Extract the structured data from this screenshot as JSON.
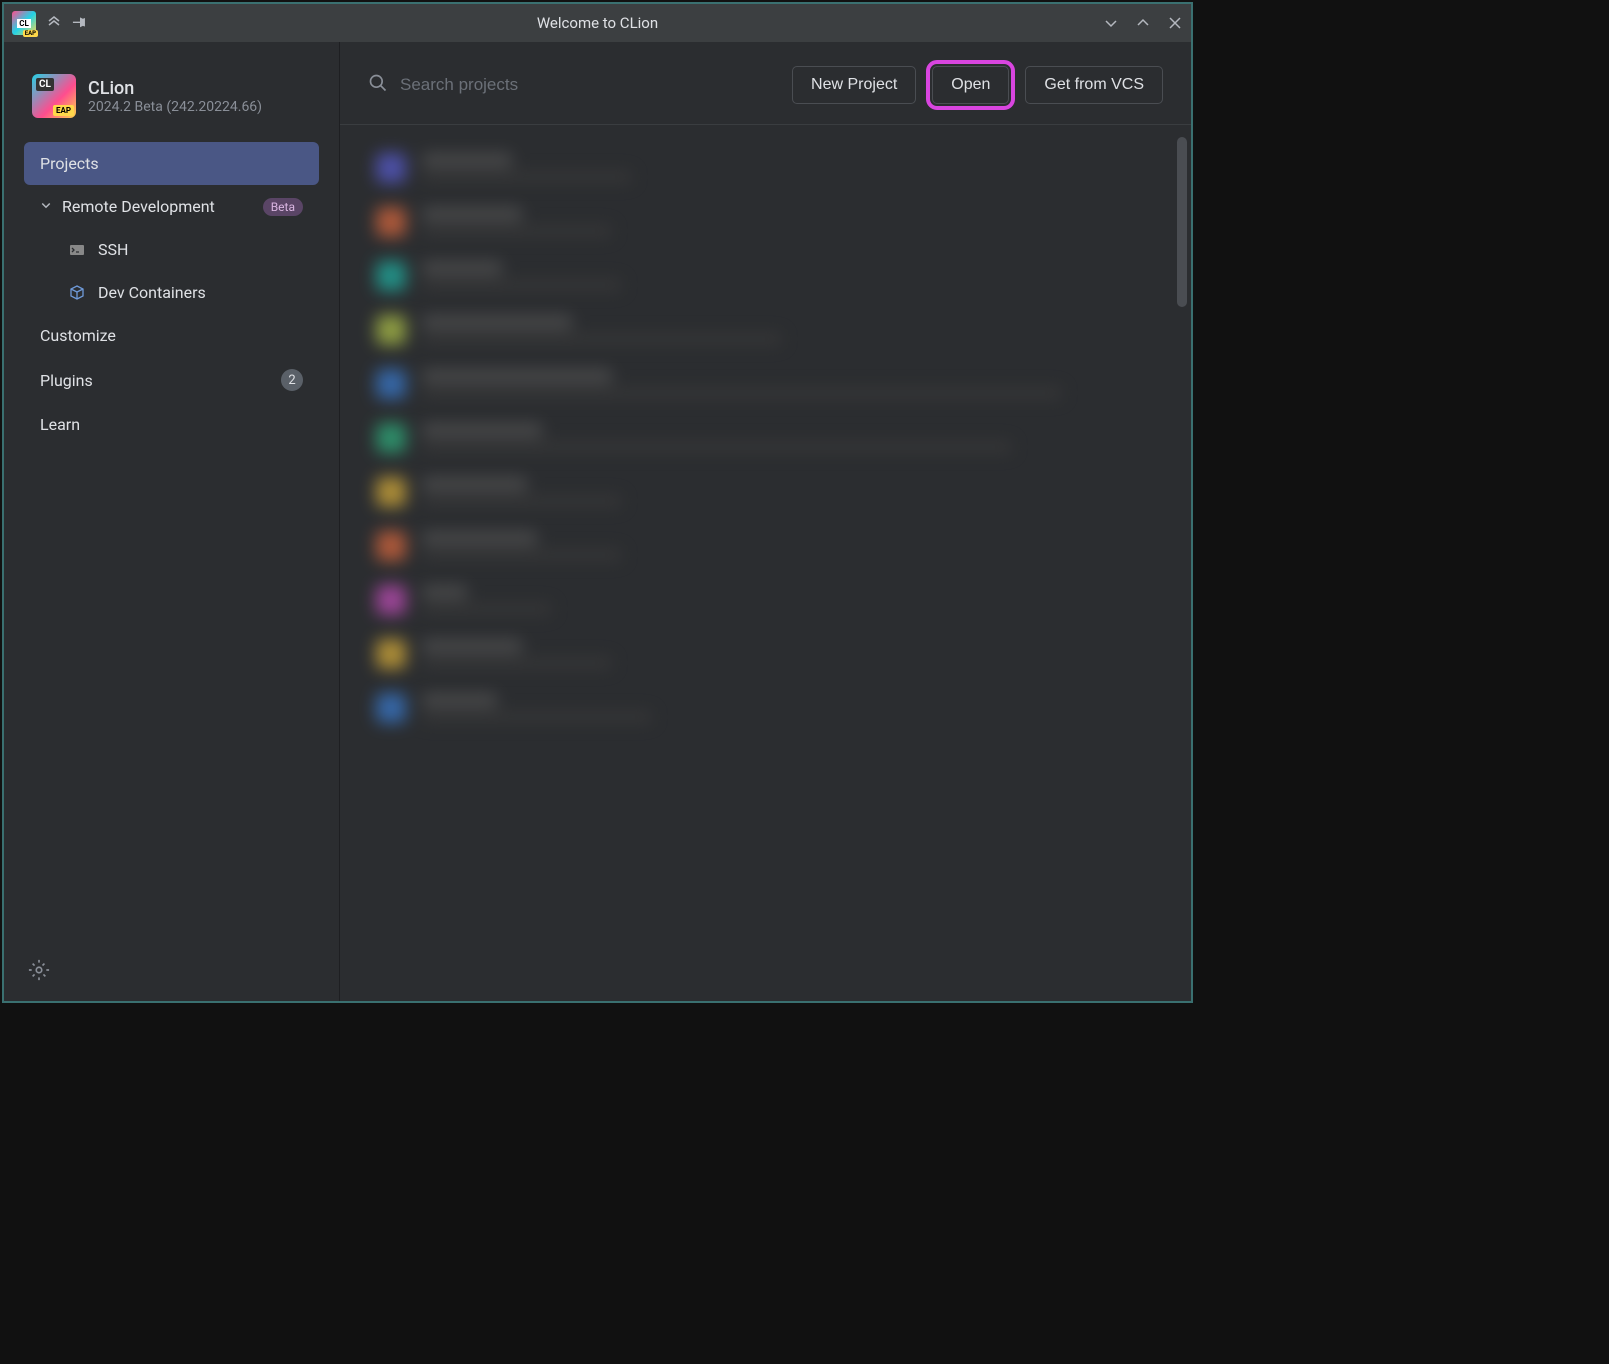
{
  "titlebar": {
    "title": "Welcome to CLion"
  },
  "app": {
    "name": "CLion",
    "version": "2024.2 Beta (242.20224.66)"
  },
  "sidebar": {
    "projects": "Projects",
    "remote": "Remote Development",
    "remote_badge": "Beta",
    "ssh": "SSH",
    "dev_containers": "Dev Containers",
    "customize": "Customize",
    "plugins": "Plugins",
    "plugins_count": "2",
    "learn": "Learn"
  },
  "toolbar": {
    "search_placeholder": "Search projects",
    "new_project": "New Project",
    "open": "Open",
    "get_from_vcs": "Get from VCS"
  },
  "projects": [
    {
      "color": "#5a5ed6",
      "title_w": 90,
      "path_w": 210
    },
    {
      "color": "#e06a3e",
      "title_w": 100,
      "path_w": 190
    },
    {
      "color": "#1fb6a8",
      "title_w": 80,
      "path_w": 200
    },
    {
      "color": "#b5c94a",
      "title_w": 150,
      "path_w": 360
    },
    {
      "color": "#3a7ed6",
      "title_w": 190,
      "path_w": 640
    },
    {
      "color": "#2fb380",
      "title_w": 120,
      "path_w": 590
    },
    {
      "color": "#e0b33a",
      "title_w": 105,
      "path_w": 200
    },
    {
      "color": "#e06a3e",
      "title_w": 115,
      "path_w": 200
    },
    {
      "color": "#c74fbf",
      "title_w": 45,
      "path_w": 130
    },
    {
      "color": "#e0b33a",
      "title_w": 100,
      "path_w": 190
    },
    {
      "color": "#3a7ed6",
      "title_w": 75,
      "path_w": 230
    }
  ]
}
